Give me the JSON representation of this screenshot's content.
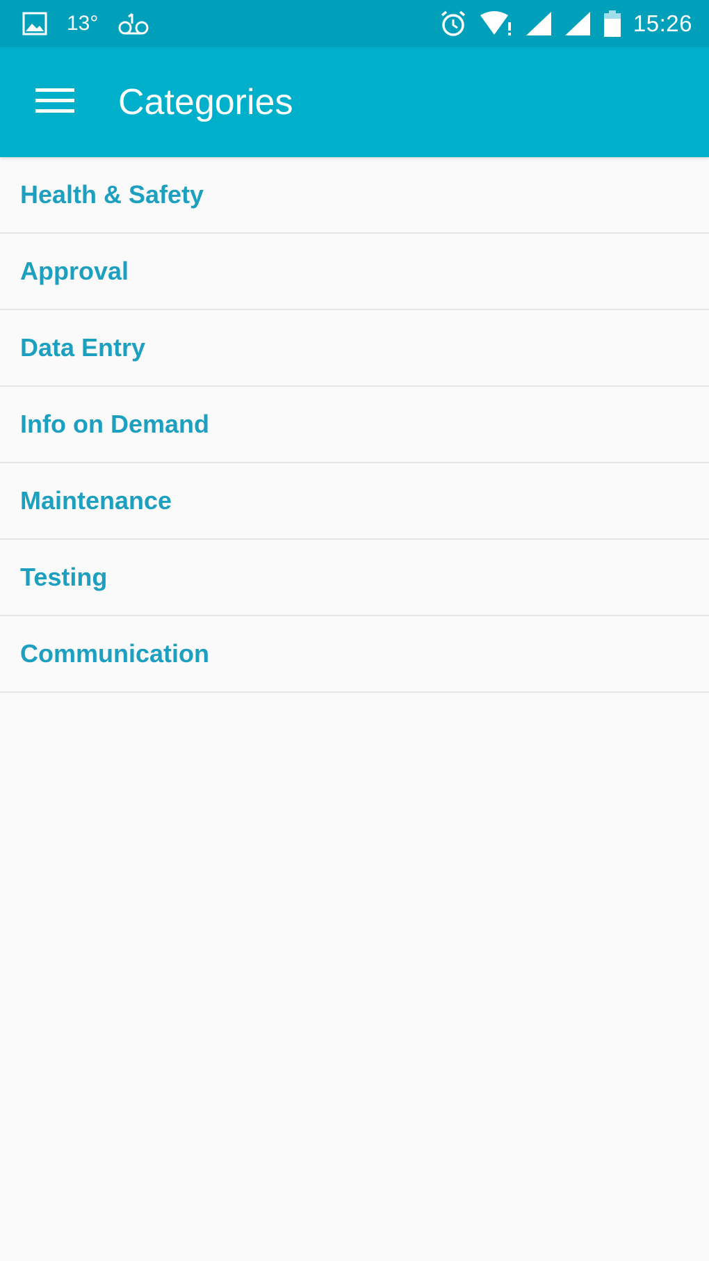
{
  "status_bar": {
    "temperature": "13°",
    "time": "15:26",
    "icons": [
      "gallery-icon",
      "voicemail-icon",
      "alarm-icon",
      "wifi-icon",
      "signal-icon",
      "signal-icon",
      "battery-icon"
    ]
  },
  "app_bar": {
    "title": "Categories",
    "menu_icon": "hamburger-menu-icon"
  },
  "categories": [
    {
      "label": "Health & Safety"
    },
    {
      "label": "Approval"
    },
    {
      "label": "Data Entry"
    },
    {
      "label": "Info on Demand"
    },
    {
      "label": "Maintenance"
    },
    {
      "label": "Testing"
    },
    {
      "label": "Communication"
    }
  ],
  "colors": {
    "status_bar": "#00a0bb",
    "app_bar": "#00afc9",
    "item_text": "#1d9fc0",
    "background": "#fafafa",
    "divider": "#e6e6e6"
  }
}
